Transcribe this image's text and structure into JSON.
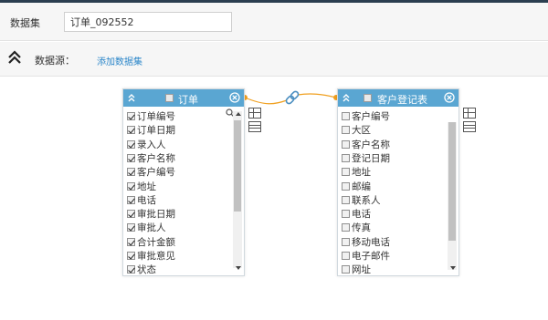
{
  "dataset": {
    "label": "数据集",
    "name_value": "订单_092552"
  },
  "datasource": {
    "label": "数据源：",
    "add_link": "添加数据集"
  },
  "tables": [
    {
      "title": "订单",
      "fields": [
        {
          "label": "订单编号",
          "checked": true
        },
        {
          "label": "订单日期",
          "checked": true
        },
        {
          "label": "录入人",
          "checked": true
        },
        {
          "label": "客户名称",
          "checked": true
        },
        {
          "label": "客户编号",
          "checked": true
        },
        {
          "label": "地址",
          "checked": true
        },
        {
          "label": "电话",
          "checked": true
        },
        {
          "label": "审批日期",
          "checked": true
        },
        {
          "label": "审批人",
          "checked": true
        },
        {
          "label": "合计金额",
          "checked": true
        },
        {
          "label": "审批意见",
          "checked": true
        },
        {
          "label": "状态",
          "checked": true
        }
      ]
    },
    {
      "title": "客户登记表",
      "fields": [
        {
          "label": "客户编号",
          "checked": false
        },
        {
          "label": "大区",
          "checked": false
        },
        {
          "label": "客户名称",
          "checked": false
        },
        {
          "label": "登记日期",
          "checked": false
        },
        {
          "label": "地址",
          "checked": false
        },
        {
          "label": "邮编",
          "checked": false
        },
        {
          "label": "联系人",
          "checked": false
        },
        {
          "label": "电话",
          "checked": false
        },
        {
          "label": "传真",
          "checked": false
        },
        {
          "label": "移动电话",
          "checked": false
        },
        {
          "label": "电子邮件",
          "checked": false
        },
        {
          "label": "网址",
          "checked": false
        }
      ]
    }
  ],
  "icons": {
    "collapse": "double-chevron-up-icon",
    "link": "chain-link-icon",
    "close": "close-circle-icon",
    "search": "search-icon",
    "grid": "table-grid-icon",
    "rows": "table-rows-icon"
  },
  "colors": {
    "header_blue": "#5aa6d2",
    "link_blue": "#2b86c9",
    "connector_orange": "#f0a020",
    "top_bar": "#2b3e50"
  }
}
